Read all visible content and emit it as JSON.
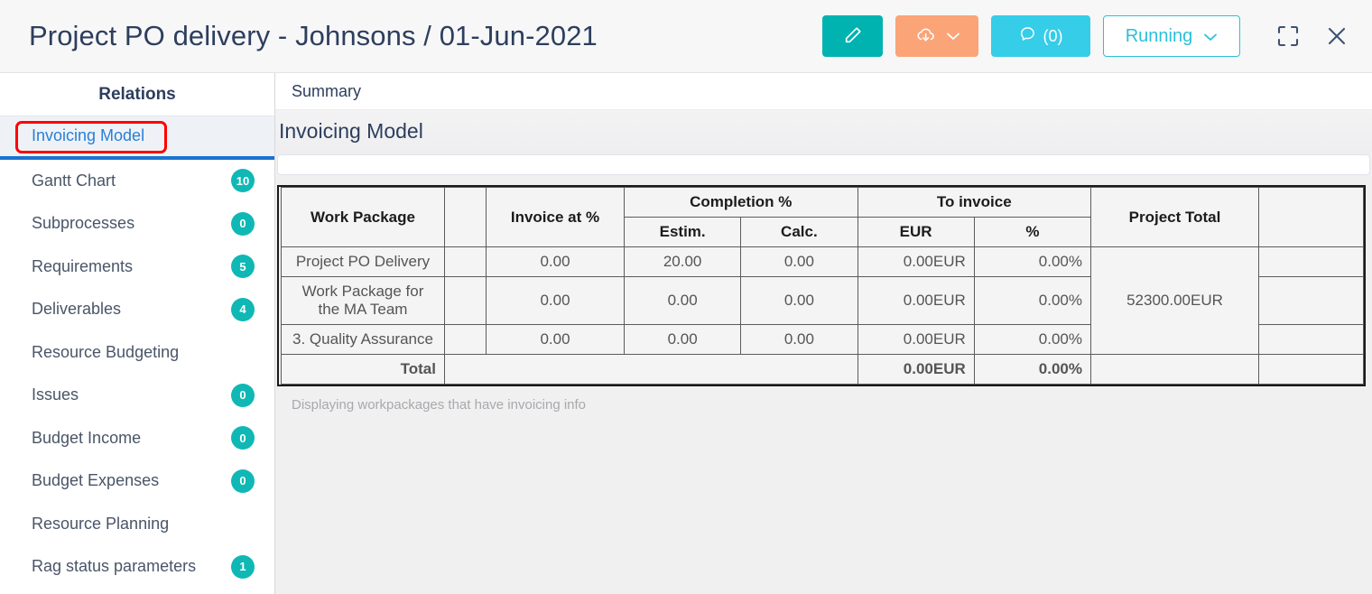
{
  "header": {
    "title": "Project PO delivery - Johnsons / 01-Jun-2021",
    "edit_icon": "pencil-icon",
    "download_icon": "cloud-download-icon",
    "download_chevron": "chevron-down-icon",
    "comments_icon": "comment-bubble-icon",
    "comments_label": "(0)",
    "status_label": "Running",
    "status_chevron": "chevron-down-icon",
    "fullscreen_icon": "fullscreen-icon",
    "close_icon": "close-icon"
  },
  "colors": {
    "teal": "#00b3b0",
    "orange": "#fba478",
    "cyan": "#35cde8",
    "status_border": "#2bc0d8",
    "badge": "#0fb8b4",
    "selected_text": "#2a7fd4",
    "selected_underline": "#1a73d0",
    "annotation": "#ff0000"
  },
  "sidebar": {
    "title": "Relations",
    "items": [
      {
        "label": "Invoicing Model",
        "badge": null,
        "selected": true
      },
      {
        "label": "Gantt Chart",
        "badge": "10",
        "selected": false
      },
      {
        "label": "Subprocesses",
        "badge": "0",
        "selected": false
      },
      {
        "label": "Requirements",
        "badge": "5",
        "selected": false
      },
      {
        "label": "Deliverables",
        "badge": "4",
        "selected": false
      },
      {
        "label": "Resource Budgeting",
        "badge": null,
        "selected": false
      },
      {
        "label": "Issues",
        "badge": "0",
        "selected": false
      },
      {
        "label": "Budget Income",
        "badge": "0",
        "selected": false
      },
      {
        "label": "Budget Expenses",
        "badge": "0",
        "selected": false
      },
      {
        "label": "Resource Planning",
        "badge": null,
        "selected": false
      },
      {
        "label": "Rag status parameters",
        "badge": "1",
        "selected": false
      }
    ]
  },
  "main": {
    "tab_label": "Summary",
    "panel_heading": "Invoicing Model",
    "footnote": "Displaying workpackages that have invoicing info",
    "table": {
      "headers": {
        "work_package": "Work Package",
        "blank": "",
        "invoice_at": "Invoice at %",
        "completion": "Completion %",
        "completion_estim": "Estim.",
        "completion_calc": "Calc.",
        "to_invoice": "To invoice",
        "to_invoice_eur": "EUR",
        "to_invoice_pct": "%",
        "project_total": "Project Total",
        "last": ""
      },
      "rows": [
        {
          "work_package": "Project PO Delivery",
          "blank": "",
          "invoice_at": "0.00",
          "estim": "20.00",
          "calc": "0.00",
          "eur": "0.00EUR",
          "pct": "0.00%"
        },
        {
          "work_package": "Work Package for the MA Team",
          "blank": "",
          "invoice_at": "0.00",
          "estim": "0.00",
          "calc": "0.00",
          "eur": "0.00EUR",
          "pct": "0.00%"
        },
        {
          "work_package": "3. Quality Assurance",
          "blank": "",
          "invoice_at": "0.00",
          "estim": "0.00",
          "calc": "0.00",
          "eur": "0.00EUR",
          "pct": "0.00%"
        }
      ],
      "project_total_value": "52300.00EUR",
      "total_row": {
        "label": "Total",
        "eur": "0.00EUR",
        "pct": "0.00%"
      }
    }
  }
}
